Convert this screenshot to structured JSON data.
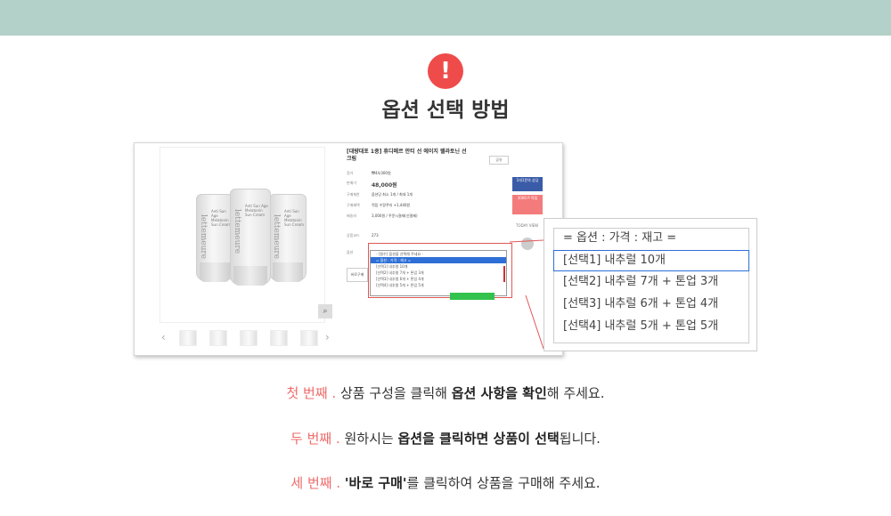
{
  "header": {
    "title": "옵션 선택 방법",
    "alert_symbol": "!"
  },
  "colors": {
    "topbar": "#b3d0c9",
    "alert": "#ef4b4b",
    "accent": "#ef6a6a",
    "selection": "#2d6fd6"
  },
  "product": {
    "name": "[대량대포 1중] 휴디메르 안티 선 에이지 렐라토닌 선크림",
    "share_label": "공유",
    "brand_vertical": "lettemeure",
    "tube_text": "Anti Sun Age Melatonin Sun Cream",
    "rows": [
      {
        "label": "정가",
        "value": "₩44,000원"
      },
      {
        "label": "판매가",
        "value": "48,000원"
      },
      {
        "label": "구매제한",
        "value": "옵션당 최소 1개 / 최대 1개"
      },
      {
        "label": "구매혜택",
        "value": "적립 수량쿠지 +1,440원"
      },
      {
        "label": "배송비",
        "value": "3,000원 / 주문시결제(선결제)"
      },
      {
        "label": "상품코드",
        "value": "273"
      }
    ],
    "option_label": "옵션",
    "dropdown_options": [
      "- [필수] 옵션을 선택해 주세요 -",
      "= 옵션 : 가격 : 재고 =",
      "[선택1] 내추럴 10개",
      "[선택2] 내추럴 7개 + 톤업 3개",
      "[선택3] 내추럴 6개 + 톤업 4개",
      "[선택4] 내추럴 5개 + 톤업 5개"
    ],
    "buy_label": "바로구매",
    "side_badge1": "1대1문의 상담",
    "side_badge2": "3000 P 적립",
    "today_label": "TODAY VIEW"
  },
  "zoom": {
    "options": [
      "= 옵션 : 가격 : 재고 =",
      "[선택1] 내추럴 10개",
      "[선택2] 내추럴 7개 + 톤업 3개",
      "[선택3] 내추럴 6개 + 톤업 4개",
      "[선택4] 내추럴 5개 + 톤업 5개"
    ]
  },
  "steps": [
    {
      "num": "첫 번째 .",
      "a": "상품 구성을 클릭해 ",
      "b": "옵션 사항을 확인",
      "c": "해 주세요."
    },
    {
      "num": "두 번째 .",
      "a": "원하시는 ",
      "b": "옵션을 클릭하면 상품이 선택",
      "c": "됩니다."
    },
    {
      "num": "세 번째 .",
      "a": "",
      "b": "'바로 구매'",
      "c": "를 클릭하여 상품을 구매해 주세요."
    }
  ]
}
